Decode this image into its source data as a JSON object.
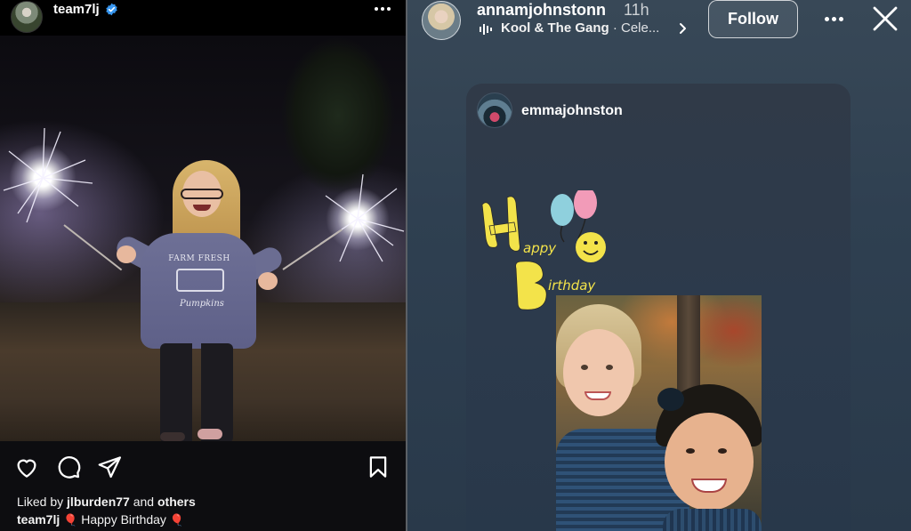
{
  "post": {
    "username": "team7lj",
    "liked_by_prefix": "Liked by ",
    "liked_by_user": "jlburden77",
    "liked_by_middle": " and ",
    "liked_by_others": "others",
    "caption_user": "team7lj",
    "caption_text": "Happy Birthday",
    "caption_emoji": "🎈",
    "photo_text": {
      "sweater_top": "FARM FRESH",
      "sweater_bottom": "Pumpkins"
    },
    "icons": {
      "verified": "verified-badge-icon",
      "more": "more-horizontal-icon",
      "like": "heart-icon",
      "comment": "comment-icon",
      "share": "send-icon",
      "save": "bookmark-icon"
    }
  },
  "story": {
    "username": "annamjohnstonn",
    "time": "11h",
    "music_artist": "Kool & The Gang",
    "music_song": " · Cele...",
    "follow_label": "Follow",
    "shared_post": {
      "username": "emmajohnston",
      "sticker_text": "Happy Birthday"
    },
    "icons": {
      "music": "music-bars-icon",
      "chevron": "chevron-right-icon",
      "more": "more-horizontal-icon",
      "close": "close-icon"
    }
  },
  "colors": {
    "verified_blue": "#3897f0",
    "balloon_red": "#e0243e",
    "sticker_yellow": "#f3e34a",
    "balloon_blue": "#8fd0dd",
    "balloon_pink": "#f29bb8"
  }
}
